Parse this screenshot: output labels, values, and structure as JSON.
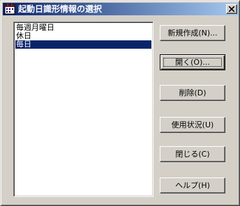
{
  "window": {
    "title": "起動日識形情報の選択"
  },
  "list": {
    "items": [
      {
        "label": "毎週月曜日",
        "selected": false
      },
      {
        "label": "休日",
        "selected": false
      },
      {
        "label": "毎日",
        "selected": true
      }
    ]
  },
  "buttons": {
    "new": "新規作成(N)...",
    "open": "開く(O)...",
    "delete": "削除(D)",
    "usage": "使用状況(U)",
    "close": "閉じる(C)",
    "help": "ヘルプ(H)"
  },
  "colors": {
    "title_active": "#0a246a",
    "title_gradient_end": "#a6caf0",
    "selection": "#0a246a",
    "face": "#d4d0c8"
  },
  "icons": {
    "app": "calendar-icon",
    "close": "close-icon"
  }
}
